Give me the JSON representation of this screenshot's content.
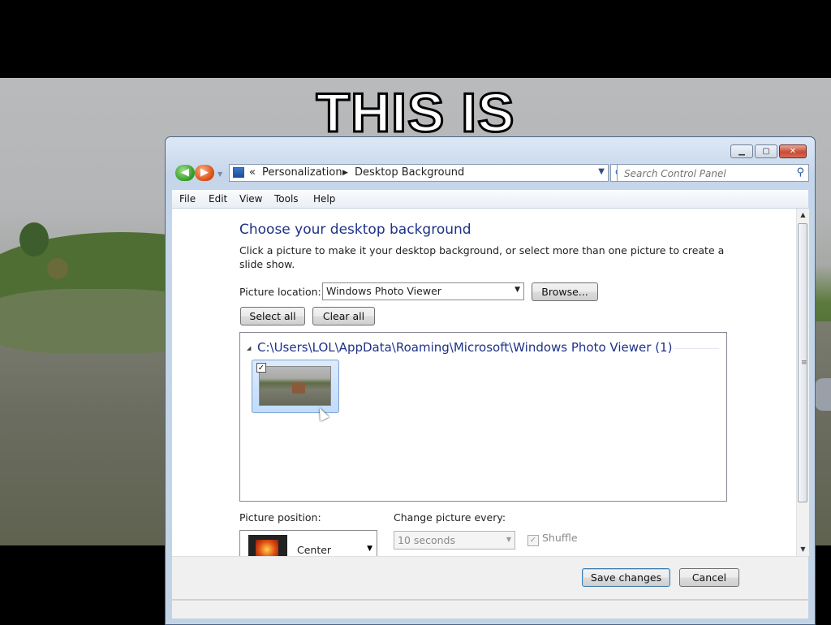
{
  "background": {
    "caption": "THIS IS"
  },
  "window": {
    "controls": {
      "minimize": "minimize-icon",
      "maximize": "maximize-icon",
      "close": "close-icon"
    },
    "nav": {
      "back_icon": "back-arrow-icon",
      "forward_icon": "forward-arrow-icon",
      "chevron": "«",
      "breadcrumb": [
        "Personalization",
        "Desktop Background"
      ],
      "refresh_icon": "refresh-icon"
    },
    "search": {
      "placeholder": "Search Control Panel",
      "icon": "search-icon"
    },
    "menu": [
      "File",
      "Edit",
      "View",
      "Tools",
      "Help"
    ]
  },
  "page": {
    "title": "Choose your desktop background",
    "description": "Click a picture to make it your desktop background, or select more than one picture to create a slide show.",
    "location_label": "Picture location:",
    "location_value": "Windows Photo Viewer",
    "browse_label": "Browse...",
    "select_all_label": "Select all",
    "clear_all_label": "Clear all",
    "group_path": "C:\\Users\\LOL\\AppData\\Roaming\\Microsoft\\Windows Photo Viewer (1)",
    "thumbnail_checked": "✓",
    "position_label": "Picture position:",
    "position_value": "Center",
    "change_label": "Change picture every:",
    "change_value": "10 seconds",
    "shuffle_label": "Shuffle",
    "shuffle_checked": "✓"
  },
  "footer": {
    "save_label": "Save changes",
    "cancel_label": "Cancel"
  }
}
